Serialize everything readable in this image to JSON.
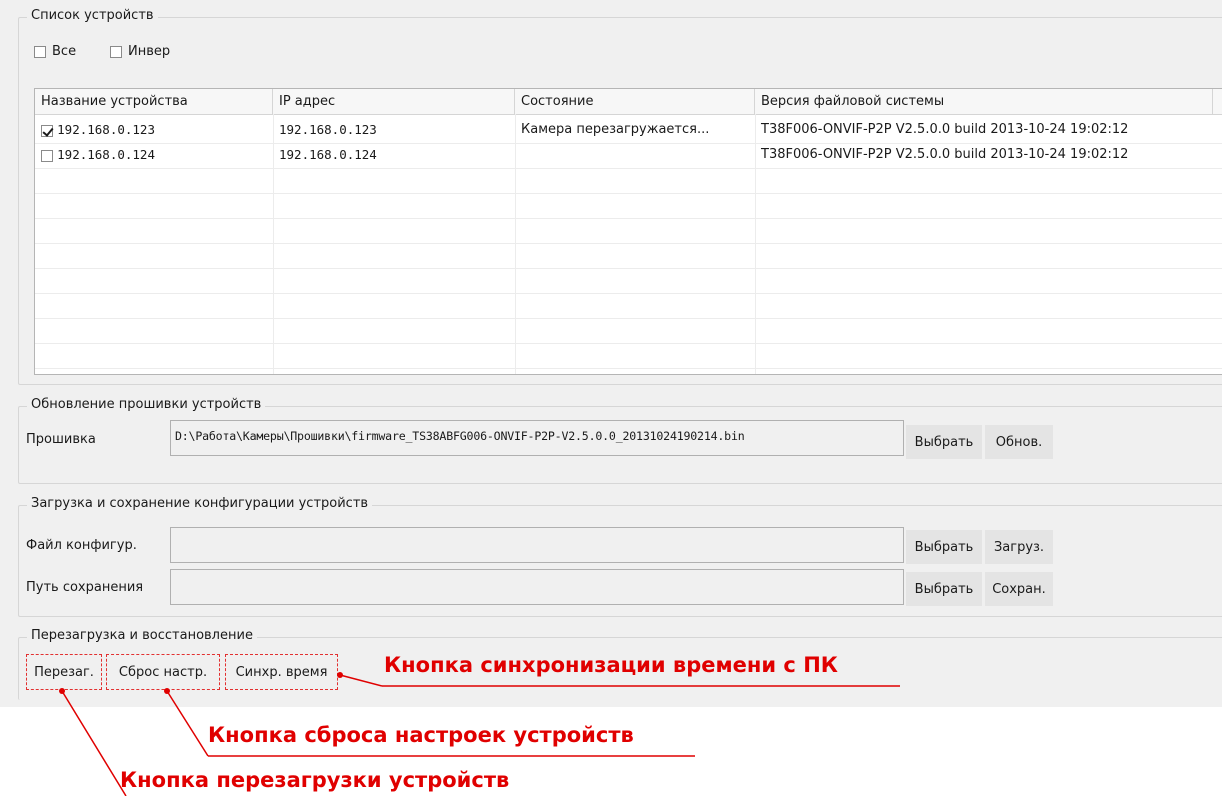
{
  "device_list": {
    "title": "Список устройств",
    "check_all": {
      "label": "Все",
      "checked": false
    },
    "check_invert": {
      "label": "Инвер",
      "checked": false
    },
    "columns": [
      "Название устройства",
      "IP адрес",
      "Состояние",
      "Версия файловой системы"
    ],
    "rows": [
      {
        "checked": true,
        "name": "192.168.0.123",
        "ip": "192.168.0.123",
        "state": "Камера перезагружается...",
        "fs_version": "T38F006-ONVIF-P2P V2.5.0.0 build 2013-10-24 19:02:12"
      },
      {
        "checked": false,
        "name": "192.168.0.124",
        "ip": "192.168.0.124",
        "state": "",
        "fs_version": "T38F006-ONVIF-P2P V2.5.0.0 build 2013-10-24 19:02:12"
      }
    ]
  },
  "firmware": {
    "title": "Обновление прошивки устройств",
    "label": "Прошивка",
    "path": "D:\\Работа\\Камеры\\Прошивки\\firmware_TS38ABFG006-ONVIF-P2P-V2.5.0.0_20131024190214.bin",
    "choose_label": "Выбрать",
    "update_label": "Обнов."
  },
  "config": {
    "title": "Загрузка и сохранение конфигурации устройств",
    "file_label": "Файл конфигур.",
    "file_value": "",
    "save_path_label": "Путь сохранения",
    "save_path_value": "",
    "choose_label_1": "Выбрать",
    "load_label": "Загруз.",
    "choose_label_2": "Выбрать",
    "save_label": "Сохран."
  },
  "reboot": {
    "title": "Перезагрузка и восстановление",
    "reboot_label": "Перезаг.",
    "reset_label": "Сброс настр.",
    "sync_label": "Синхр. время"
  },
  "annotations": {
    "sync": "Кнопка синхронизации времени с ПК",
    "reset": "Кнопка сброса настроек устройств",
    "reboot": "Кнопка перезагрузки устройств",
    "color": "#e00000"
  }
}
